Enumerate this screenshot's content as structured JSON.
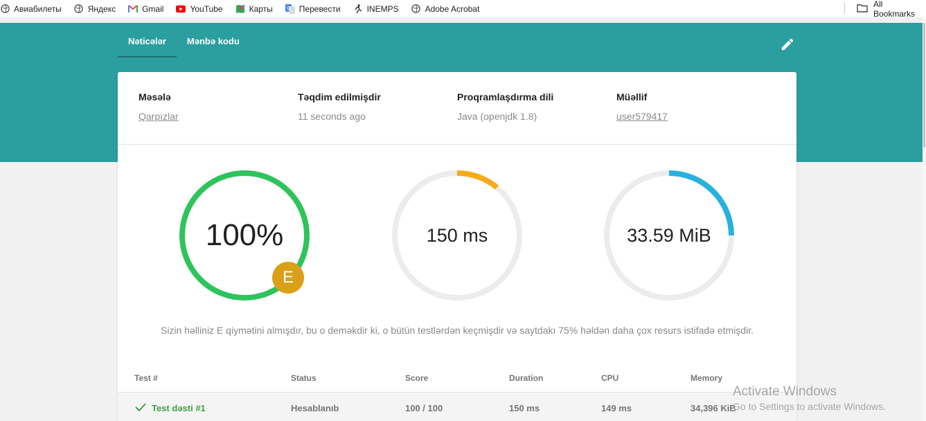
{
  "bookmarks": {
    "items": [
      {
        "label": "Авиабилеты",
        "icon": "globe-icon"
      },
      {
        "label": "Яндекс",
        "icon": "globe-icon"
      },
      {
        "label": "Gmail",
        "icon": "gmail-icon"
      },
      {
        "label": "YouTube",
        "icon": "youtube-icon"
      },
      {
        "label": "Карты",
        "icon": "maps-icon"
      },
      {
        "label": "Перевести",
        "icon": "translate-icon"
      },
      {
        "label": "INEMPS",
        "icon": "runner-icon"
      },
      {
        "label": "Adobe Acrobat",
        "icon": "globe-icon"
      }
    ],
    "all_bookmarks": "All Bookmarks"
  },
  "tabs": {
    "results": "Nəticələr",
    "source": "Mənbə kodu"
  },
  "meta": {
    "problem_label": "Məsələ",
    "problem_value": "Qarpızlar",
    "submitted_label": "Təqdim edilmişdir",
    "submitted_value": "11 seconds ago",
    "language_label": "Proqramlaşdırma dili",
    "language_value": "Java (openjdk 1.8)",
    "author_label": "Müəllif",
    "author_value": "user579417"
  },
  "gauges": {
    "score": {
      "text": "100%",
      "fraction": 1.0,
      "color": "#2ec45b",
      "grade": "E"
    },
    "time": {
      "text": "150 ms",
      "fraction": 0.11,
      "color": "#f6ab1b"
    },
    "memory": {
      "text": "33.59 MiB",
      "fraction": 0.25,
      "color": "#28b1dd"
    }
  },
  "summary": "Sizin həlliniz E qiymətini almışdır, bu o deməkdir ki, o bütün testlərdən keçmişdir və saytdakı 75% həldən daha çox resurs istifadə etmişdir.",
  "table": {
    "headers": {
      "test": "Test #",
      "status": "Status",
      "score": "Score",
      "duration": "Duration",
      "cpu": "CPU",
      "memory": "Memory"
    },
    "rows": [
      {
        "name": "Test dəsti #1",
        "status": "Hesablanıb",
        "score": "100 / 100",
        "duration": "150 ms",
        "cpu": "149 ms",
        "memory": "34,396 KiB"
      }
    ]
  },
  "watermark": {
    "line1": "Activate Windows",
    "line2": "Go to Settings to activate Windows."
  },
  "colors": {
    "header_teal": "#2b9ea0",
    "success_green": "#43a047",
    "grade_gold": "#d9a018"
  }
}
